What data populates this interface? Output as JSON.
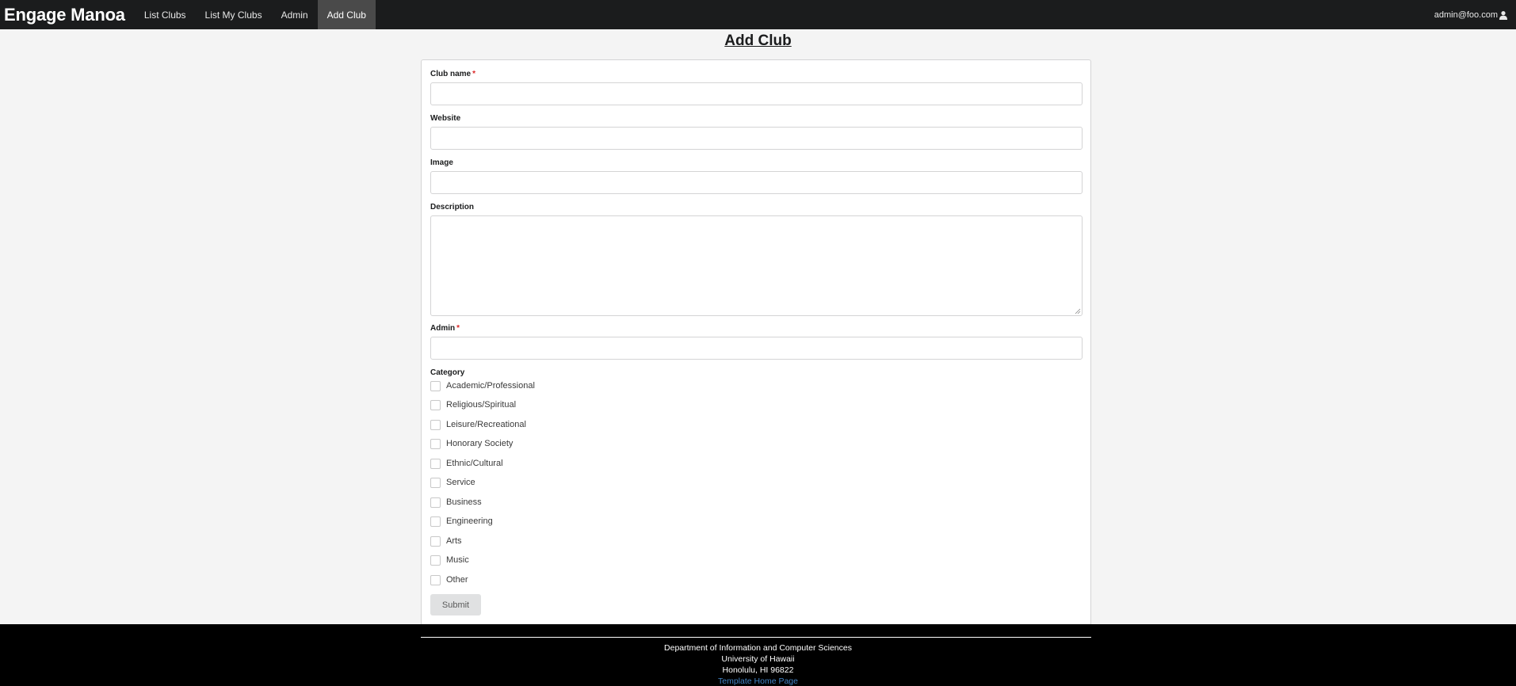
{
  "navbar": {
    "brand": "Engage Manoa",
    "items": [
      {
        "label": "List Clubs"
      },
      {
        "label": "List My Clubs"
      },
      {
        "label": "Admin"
      },
      {
        "label": "Add Club",
        "active": true
      }
    ],
    "user": "admin@foo.com",
    "user_icon": "user-icon"
  },
  "page": {
    "title": "Add Club"
  },
  "form": {
    "club_name": {
      "label": "Club name",
      "required": true,
      "value": ""
    },
    "website": {
      "label": "Website",
      "value": ""
    },
    "image": {
      "label": "Image",
      "value": ""
    },
    "description": {
      "label": "Description",
      "value": ""
    },
    "admin": {
      "label": "Admin",
      "required": true,
      "value": ""
    },
    "category": {
      "label": "Category",
      "options": [
        {
          "label": "Academic/Professional",
          "checked": false
        },
        {
          "label": "Religious/Spiritual",
          "checked": false
        },
        {
          "label": "Leisure/Recreational",
          "checked": false
        },
        {
          "label": "Honorary Society",
          "checked": false
        },
        {
          "label": "Ethnic/Cultural",
          "checked": false
        },
        {
          "label": "Service",
          "checked": false
        },
        {
          "label": "Business",
          "checked": false
        },
        {
          "label": "Engineering",
          "checked": false
        },
        {
          "label": "Arts",
          "checked": false
        },
        {
          "label": "Music",
          "checked": false
        },
        {
          "label": "Other",
          "checked": false
        }
      ]
    },
    "submit_label": "Submit",
    "required_mark": "*"
  },
  "footer": {
    "line1": "Department of Information and Computer Sciences",
    "line2": "University of Hawaii",
    "line3": "Honolulu, HI 96822",
    "link": "Template Home Page"
  },
  "colors": {
    "navbar_bg": "#1b1c1d",
    "active_tab_bg": "#4a4a4a",
    "page_bg": "#f4f4f4",
    "required": "#db2828",
    "link": "#4183c4",
    "footer_bg": "#000000"
  }
}
